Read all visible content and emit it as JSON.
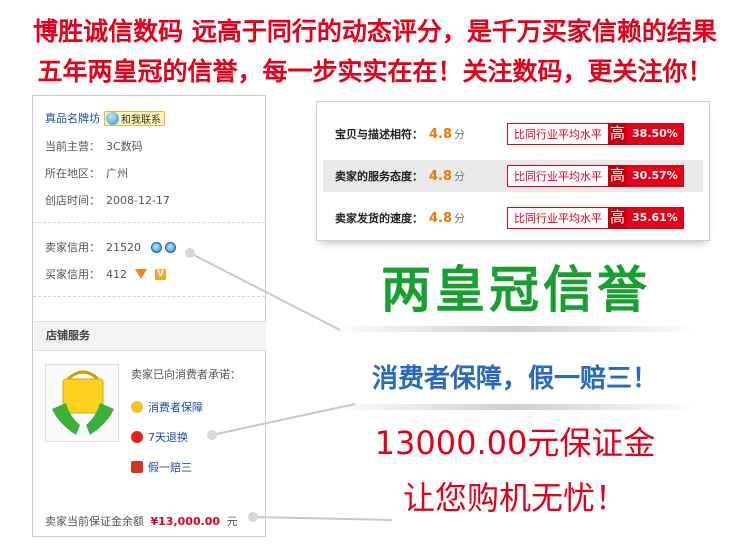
{
  "banner": {
    "line1": "博胜诚信数码 远高于同行的动态评分，是千万买家信赖的结果",
    "line2": "五年两皇冠的信誉，每一步实实在在！关注数码，更关注你！"
  },
  "shop": {
    "name": "真品名牌坊",
    "contact_button": "和我联系",
    "main_business_label": "当前主营：",
    "main_business": "3C数码",
    "region_label": "所在地区：",
    "region": "广州",
    "founded_label": "创店时间：",
    "founded": "2008-12-17",
    "seller_credit_label": "卖家信用：",
    "seller_credit": "21520",
    "buyer_credit_label": "买家信用：",
    "buyer_credit": "412"
  },
  "services": {
    "header": "店铺服务",
    "promise_intro": "卖家已向消费者承诺：",
    "items": [
      "消费者保障",
      "7天退换",
      "假一赔三"
    ],
    "deposit_label": "卖家当前保证金余额",
    "deposit_amount": "¥13,000.00",
    "deposit_unit": "元"
  },
  "rating": {
    "rows": [
      {
        "label": "宝贝与描述相符：",
        "score": "4.8",
        "unit": "分",
        "compare": "比同行业平均水平",
        "level": "高",
        "percent": "38.50%"
      },
      {
        "label": "卖家的服务态度：",
        "score": "4.8",
        "unit": "分",
        "compare": "比同行业平均水平",
        "level": "高",
        "percent": "30.57%"
      },
      {
        "label": "卖家发货的速度：",
        "score": "4.8",
        "unit": "分",
        "compare": "比同行业平均水平",
        "level": "高",
        "percent": "35.61%"
      }
    ]
  },
  "promo": {
    "crowns": "两皇冠信誉",
    "guarantee": "消费者保障，假一赔三！",
    "deposit": "13000.00元保证金",
    "worry_free": "让您购机无忧！"
  },
  "colors": {
    "brand_red": "#e2001a",
    "green": "#17a02f",
    "blue": "#2a68bb",
    "orange": "#f07800"
  },
  "icons": [
    "contact-bubble-icon",
    "crown-icon",
    "diamond-icon",
    "shopping-bag-icon",
    "shield-icon",
    "return-icon",
    "fake-icon"
  ]
}
